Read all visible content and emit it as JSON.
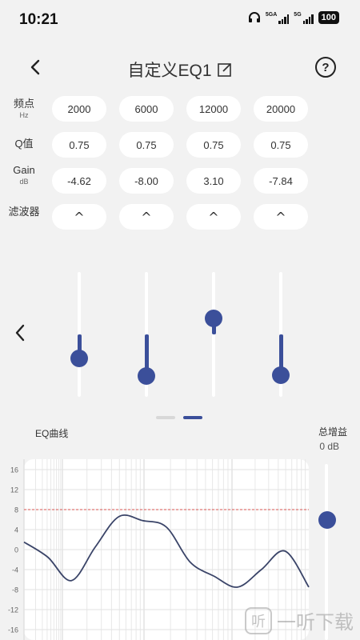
{
  "status": {
    "time": "10:21",
    "net1": "5GA",
    "net2": "5G",
    "battery": "100"
  },
  "header": {
    "title": "自定义EQ1",
    "help": "?"
  },
  "params": {
    "freq_label": "频点",
    "freq_unit": "Hz",
    "q_label": "Q值",
    "gain_label": "Gain",
    "gain_unit": "dB",
    "filter_label": "滤波器",
    "bands": [
      {
        "freq": "2000",
        "q": "0.75",
        "gain": "-4.62",
        "filter": "^"
      },
      {
        "freq": "6000",
        "q": "0.75",
        "gain": "-8.00",
        "filter": "^"
      },
      {
        "freq": "12000",
        "q": "0.75",
        "gain": "3.10",
        "filter": "^"
      },
      {
        "freq": "20000",
        "q": "0.75",
        "gain": "-7.84",
        "filter": "^"
      }
    ]
  },
  "sliders": {
    "gains_db": [
      -4.62,
      -8.0,
      3.1,
      -7.84
    ],
    "range_db": [
      -12,
      12
    ]
  },
  "pager": {
    "pages": 2,
    "active": 1
  },
  "curve_section": {
    "label": "EQ曲线",
    "total_gain_label": "总增益",
    "total_gain_value": "0 dB"
  },
  "chart_data": {
    "type": "line",
    "ylim": [
      -16,
      16
    ],
    "y_ticks": [
      "16",
      "12",
      "8",
      "4",
      "0",
      "-4",
      "-8",
      "-12",
      "-16"
    ],
    "reference_line": 8,
    "series": [
      {
        "values": [
          1.5,
          -1.5,
          -6.2,
          0.5,
          6.6,
          5.8,
          4.5,
          -2.5,
          -5.3,
          -7.5,
          -4.0,
          -0.3,
          -7.5
        ]
      }
    ],
    "legend": "none",
    "grid": true
  },
  "watermark": {
    "text": "一听下载",
    "icon_text": "听"
  }
}
